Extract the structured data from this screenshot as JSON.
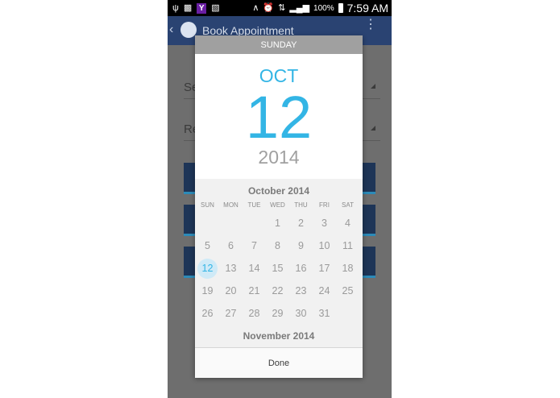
{
  "status_bar": {
    "battery_pct": "100%",
    "time": "7:59 AM",
    "icons": [
      "usb-icon",
      "gallery-icon",
      "yahoo-icon",
      "clipboard-icon",
      "bluetooth-icon",
      "alarm-icon",
      "4g-icon",
      "signal-icon",
      "battery-icon"
    ]
  },
  "app_bar": {
    "title": "Book Appointment",
    "back_icon": "back-chevron-icon",
    "menu_icon": "overflow-menu-icon"
  },
  "form": {
    "field1_label": "Se",
    "field2_label": "Re"
  },
  "dialog": {
    "day_of_week": "SUNDAY",
    "month": "OCT",
    "day": "12",
    "year": "2014",
    "calendar": {
      "title": "October 2014",
      "next_title": "November 2014",
      "weekdays": [
        "SUN",
        "MON",
        "TUE",
        "WED",
        "THU",
        "FRI",
        "SAT"
      ],
      "weeks": [
        [
          "",
          "",
          "",
          "1",
          "2",
          "3",
          "4"
        ],
        [
          "5",
          "6",
          "7",
          "8",
          "9",
          "10",
          "11"
        ],
        [
          "12",
          "13",
          "14",
          "15",
          "16",
          "17",
          "18"
        ],
        [
          "19",
          "20",
          "21",
          "22",
          "23",
          "24",
          "25"
        ],
        [
          "26",
          "27",
          "28",
          "29",
          "30",
          "31",
          ""
        ]
      ],
      "selected": "12"
    },
    "done_label": "Done"
  },
  "colors": {
    "accent": "#33b5e5",
    "app_bar": "#2a4372",
    "header_band": "#a0a0a0"
  }
}
